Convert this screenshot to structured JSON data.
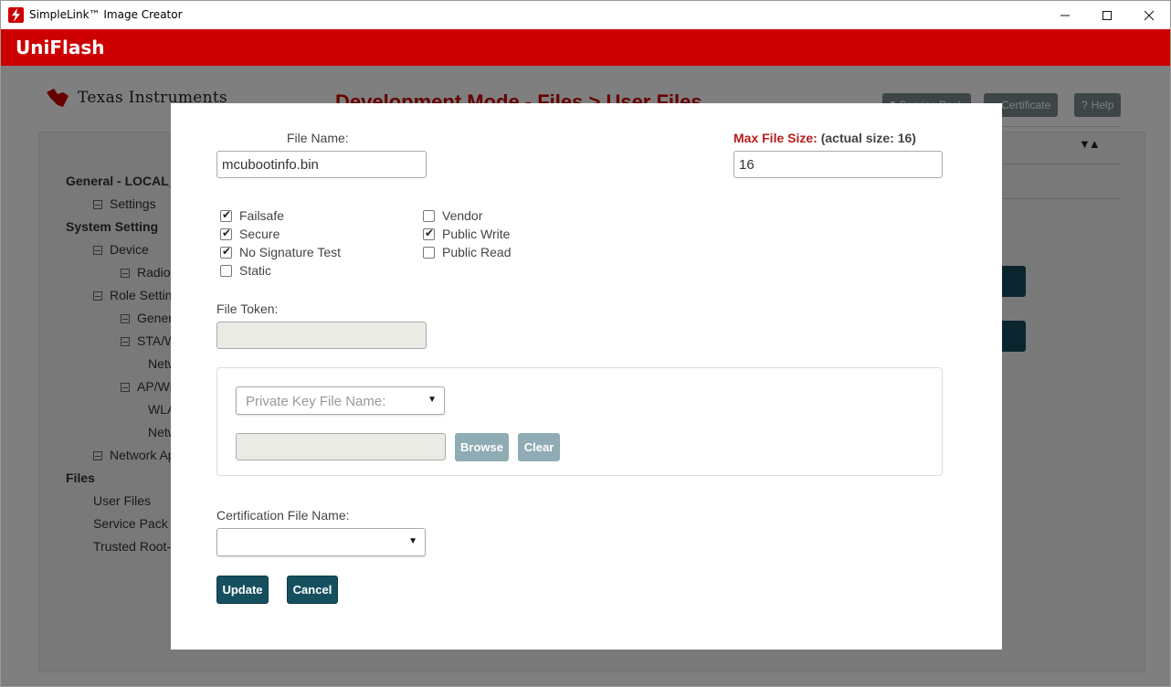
{
  "window": {
    "title": "SimpleLink™ Image Creator"
  },
  "app": {
    "brand": "UniFlash"
  },
  "background": {
    "logo_text": "Texas Instruments",
    "page_title": "Development Mode - Files > User Files",
    "top_buttons": [
      "Service Pack",
      "Certificate",
      "Help"
    ],
    "tree": [
      {
        "label": "General - LOCAL_C",
        "bold": true,
        "indent": 0,
        "box": false
      },
      {
        "label": "Settings",
        "bold": false,
        "indent": 1,
        "box": true
      },
      {
        "label": "System Setting",
        "bold": true,
        "indent": 0,
        "box": false
      },
      {
        "label": "Device",
        "bold": false,
        "indent": 1,
        "box": true
      },
      {
        "label": "Radio Se",
        "bold": false,
        "indent": 2,
        "box": true
      },
      {
        "label": "Role Settings",
        "bold": false,
        "indent": 1,
        "box": true
      },
      {
        "label": "General S",
        "bold": false,
        "indent": 2,
        "box": true
      },
      {
        "label": "STA/Wi-F",
        "bold": false,
        "indent": 2,
        "box": true
      },
      {
        "label": "Netw",
        "bold": false,
        "indent": 3,
        "box": false
      },
      {
        "label": "AP/Wi-Fi",
        "bold": false,
        "indent": 2,
        "box": true
      },
      {
        "label": "WLA",
        "bold": false,
        "indent": 3,
        "box": false
      },
      {
        "label": "Netw",
        "bold": false,
        "indent": 3,
        "box": false
      },
      {
        "label": "Network Appl",
        "bold": false,
        "indent": 1,
        "box": true
      },
      {
        "label": "Files",
        "bold": true,
        "indent": 0,
        "box": false
      },
      {
        "label": "User Files",
        "bold": false,
        "indent": 1,
        "box": false
      },
      {
        "label": "Service Pack",
        "bold": false,
        "indent": 1,
        "box": false
      },
      {
        "label": "Trusted Root-",
        "bold": false,
        "indent": 1,
        "box": false
      }
    ]
  },
  "dialog": {
    "file_name_label": "File Name:",
    "file_name_value": "mcubootinfo.bin",
    "max_size_label": "Max File Size:",
    "actual_size_label": "(actual size: 16)",
    "max_size_value": "16",
    "checkboxes_left": [
      {
        "label": "Failsafe",
        "checked": true
      },
      {
        "label": "Secure",
        "checked": true
      },
      {
        "label": "No Signature Test",
        "checked": true
      },
      {
        "label": "Static",
        "checked": false
      }
    ],
    "checkboxes_right": [
      {
        "label": "Vendor",
        "checked": false
      },
      {
        "label": "Public Write",
        "checked": true
      },
      {
        "label": "Public Read",
        "checked": false
      }
    ],
    "file_token_label": "File Token:",
    "file_token_value": "",
    "private_key_placeholder": "Private Key File Name:",
    "browse_label": "Browse",
    "clear_label": "Clear",
    "cert_label": "Certification File Name:",
    "cert_value": "",
    "update_label": "Update",
    "cancel_label": "Cancel"
  }
}
